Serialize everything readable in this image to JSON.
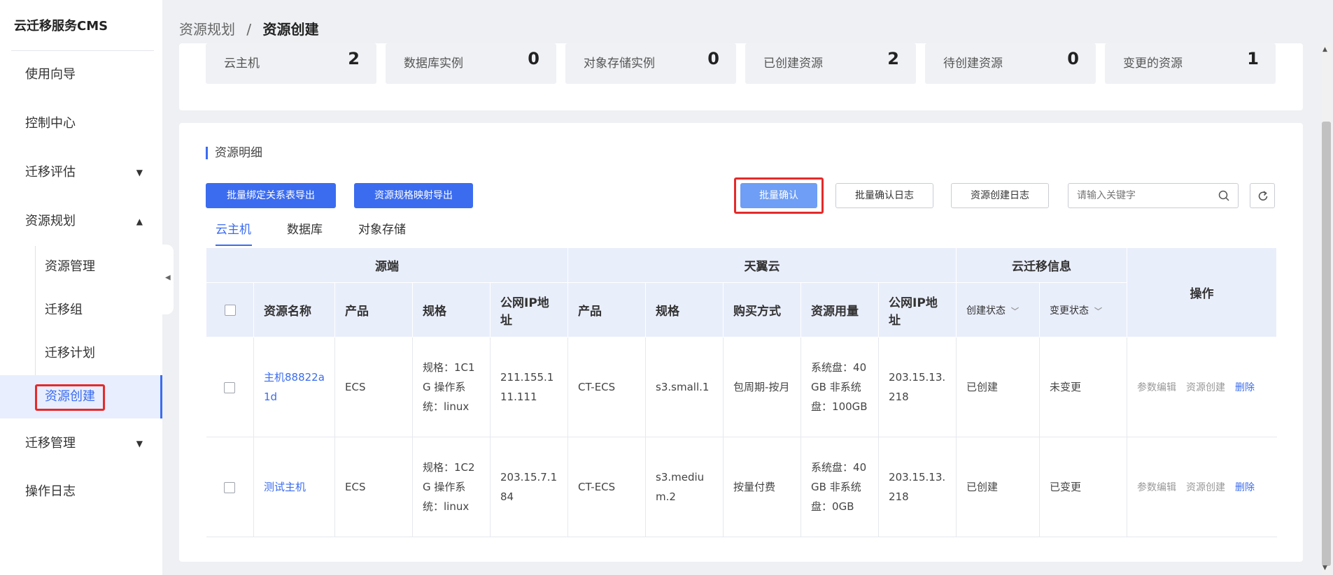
{
  "sidebar": {
    "brand": "云迁移服务CMS",
    "items": {
      "guide": "使用向导",
      "console": "控制中心",
      "assess": "迁移评估",
      "planning": "资源规划",
      "manage_migration": "迁移管理",
      "logs": "操作日志"
    },
    "sub_items": {
      "resource_manage": "资源管理",
      "migration_group": "迁移组",
      "migration_plan": "迁移计划",
      "resource_create": "资源创建"
    }
  },
  "breadcrumb": {
    "parent": "资源规划",
    "separator": "/",
    "current": "资源创建"
  },
  "summary": [
    {
      "label": "云主机",
      "value": "2"
    },
    {
      "label": "数据库实例",
      "value": "0"
    },
    {
      "label": "对象存储实例",
      "value": "0"
    },
    {
      "label": "已创建资源",
      "value": "2"
    },
    {
      "label": "待创建资源",
      "value": "0"
    },
    {
      "label": "变更的资源",
      "value": "1"
    }
  ],
  "detail": {
    "title": "资源明细",
    "buttons": {
      "export_binding": "批量绑定关系表导出",
      "export_spec": "资源规格映射导出",
      "batch_confirm": "批量确认",
      "confirm_log": "批量确认日志",
      "create_log": "资源创建日志"
    },
    "search_placeholder": "请输入关键字",
    "tabs": [
      "云主机",
      "数据库",
      "对象存储"
    ]
  },
  "table": {
    "group_headers": {
      "source": "源端",
      "ctyun": "天翼云",
      "migration_info": "云迁移信息",
      "operation": "操作"
    },
    "headers": {
      "name": "资源名称",
      "product": "产品",
      "spec": "规格",
      "public_ip": "公网IP地址",
      "target_product": "产品",
      "target_spec": "规格",
      "billing": "购买方式",
      "usage": "资源用量",
      "target_ip": "公网IP地址",
      "create_status": "创建状态",
      "change_status": "变更状态"
    },
    "rows": [
      {
        "name": "主机88822a1d",
        "product": "ECS",
        "spec": "规格：1C1G 操作系统：linux",
        "ip": "211.155.111.111",
        "target_product": "CT-ECS",
        "target_spec": "s3.small.1",
        "billing": "包周期-按月",
        "usage": "系统盘：40GB 非系统盘：100GB",
        "target_ip": "203.15.13.218",
        "create_status": "已创建",
        "change_status": "未变更",
        "actions": {
          "edit": "参数编辑",
          "create": "资源创建",
          "delete": "删除"
        }
      },
      {
        "name": "测试主机",
        "product": "ECS",
        "spec": "规格：1C2G 操作系统：linux",
        "ip": "203.15.7.184",
        "target_product": "CT-ECS",
        "target_spec": "s3.medium.2",
        "billing": "按量付费",
        "usage": "系统盘：40GB 非系统盘：0GB",
        "target_ip": "203.15.13.218",
        "create_status": "已创建",
        "change_status": "已变更",
        "actions": {
          "edit": "参数编辑",
          "create": "资源创建",
          "delete": "删除"
        }
      }
    ]
  },
  "colors": {
    "accent": "#3b6cf0",
    "highlight": "#e52a2a"
  }
}
